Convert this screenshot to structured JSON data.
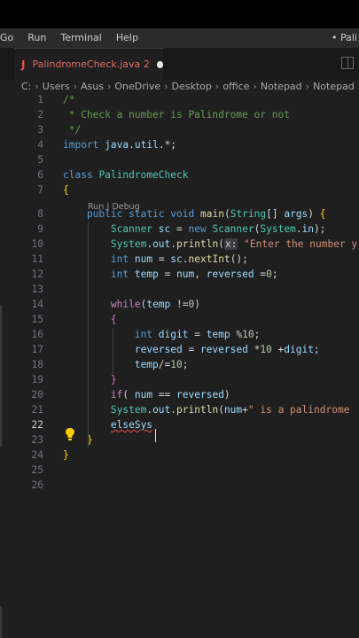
{
  "menu": [
    "Go",
    "Run",
    "Terminal",
    "Help"
  ],
  "window_title": "• Pali",
  "tab": {
    "icon_letter": "J",
    "filename": "PalindromeCheck.java 2"
  },
  "breadcrumb": [
    "C:",
    "Users",
    "Asus",
    "OneDrive",
    "Desktop",
    "office",
    "Notepad",
    "Notepad"
  ],
  "codelens": "Run | Debug",
  "active_line": 22,
  "lines": [
    {
      "n": "1",
      "t": "/*"
    },
    {
      "n": "2",
      "t": " * Check a number is Palindrome or not"
    },
    {
      "n": "3",
      "t": " */"
    },
    {
      "n": "4",
      "t": "import java.util.*;"
    },
    {
      "n": "5",
      "t": ""
    },
    {
      "n": "6",
      "t": "class PalindromeCheck"
    },
    {
      "n": "7",
      "t": "{"
    },
    {
      "n": "8",
      "t": "    public static void main(String[] args) {"
    },
    {
      "n": "9",
      "t": "        Scanner sc = new Scanner(System.in);"
    },
    {
      "n": "10",
      "t": "        System.out.println(x: \"Enter the number y"
    },
    {
      "n": "11",
      "t": "        int num = sc.nextInt();"
    },
    {
      "n": "12",
      "t": "        int temp = num, reversed =0;"
    },
    {
      "n": "13",
      "t": ""
    },
    {
      "n": "14",
      "t": "        while(temp !=0)"
    },
    {
      "n": "15",
      "t": "        {"
    },
    {
      "n": "16",
      "t": "            int digit = temp %10;"
    },
    {
      "n": "17",
      "t": "            reversed = reversed *10 +digit;"
    },
    {
      "n": "18",
      "t": "            temp/=10;"
    },
    {
      "n": "19",
      "t": "        }"
    },
    {
      "n": "20",
      "t": "        if( num == reversed)"
    },
    {
      "n": "21",
      "t": "        System.out.println(num+\" is a palindrome"
    },
    {
      "n": "22",
      "t": "        elseSys"
    },
    {
      "n": "23",
      "t": "    }"
    },
    {
      "n": "24",
      "t": "}"
    },
    {
      "n": "25",
      "t": ""
    },
    {
      "n": "26",
      "t": ""
    }
  ]
}
